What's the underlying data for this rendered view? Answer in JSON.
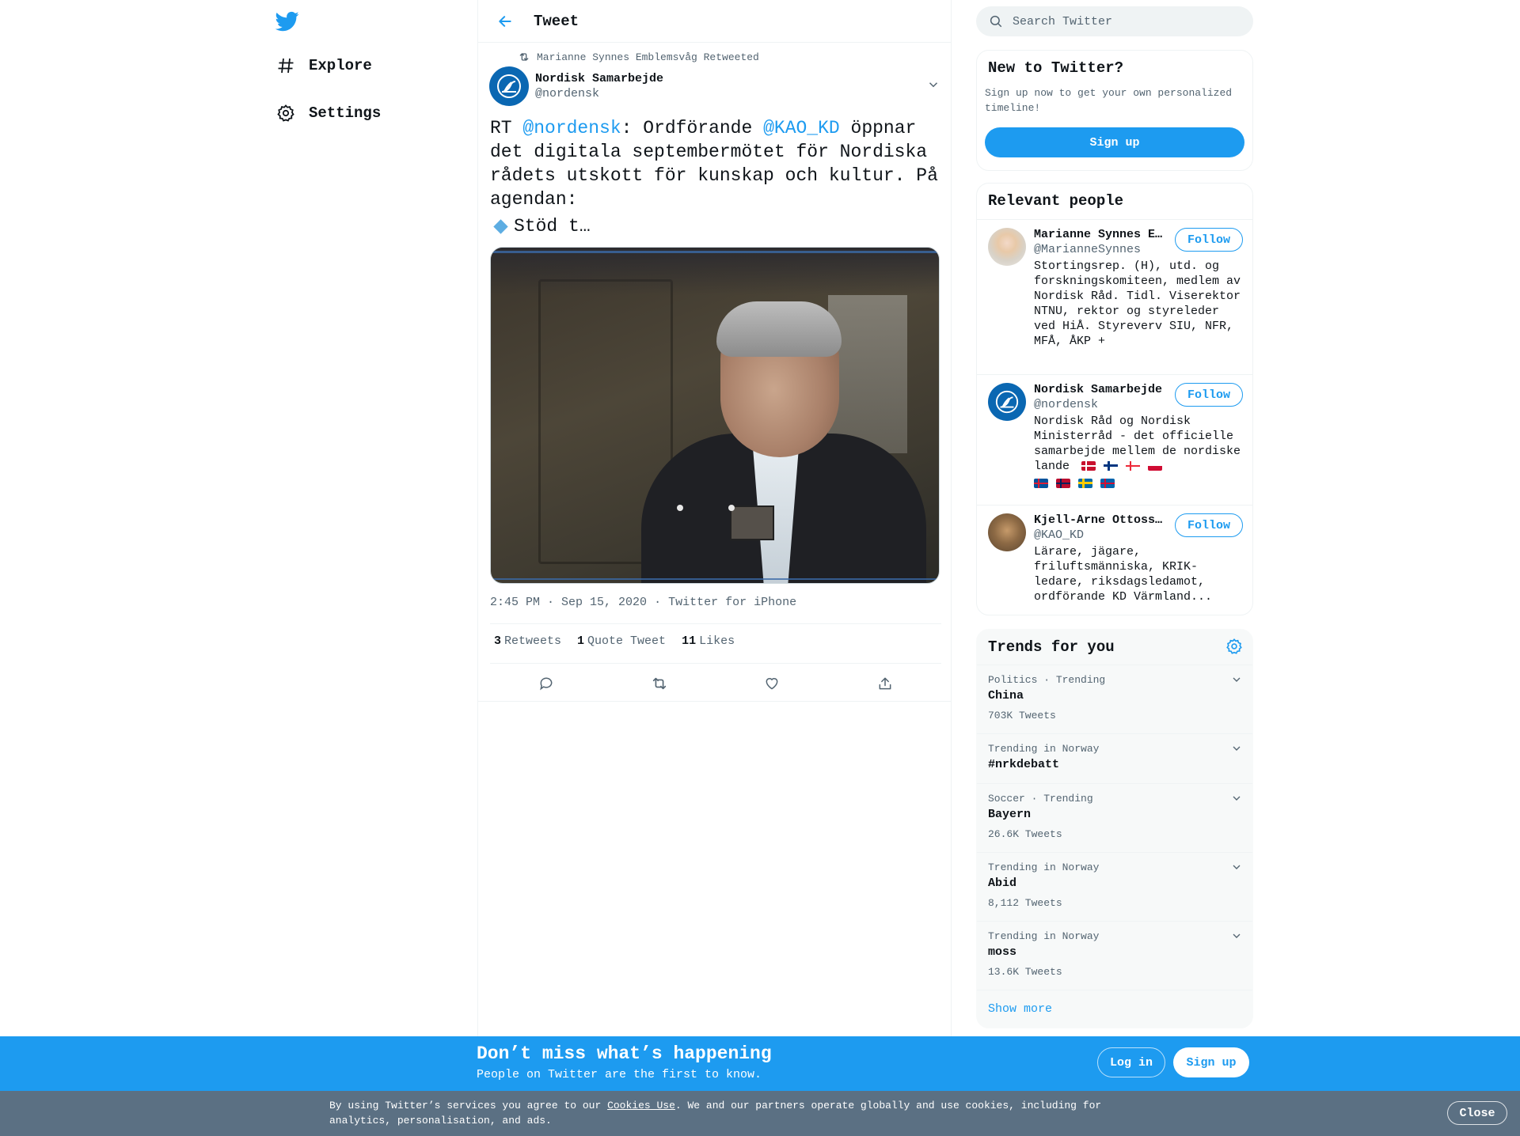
{
  "colors": {
    "accent": "#1d9bf0",
    "muted": "#536471",
    "banner": "#1d9bf0",
    "cookie_banner": "#5b7083"
  },
  "nav": {
    "logo_icon": "twitter-bird-icon",
    "items": [
      {
        "label": "Explore",
        "icon": "hashtag-icon"
      },
      {
        "label": "Settings",
        "icon": "gear-icon"
      }
    ]
  },
  "main": {
    "header_title": "Tweet",
    "retweeted_by": "Marianne Synnes Emblemsvåg Retweeted",
    "author": {
      "name": "Nordisk Samarbejde",
      "handle": "@nordensk"
    },
    "text": {
      "prefix": "RT ",
      "mention1": "@nordensk",
      "middle": ": Ordförande ",
      "mention2": "@KAO_KD",
      "rest": " öppnar det digitala septembermötet för Nordiska rådets utskott för kunskap och kultur. På agendan:",
      "line2": "Stöd t…"
    },
    "meta": {
      "time": "2:45 PM · Sep 15, 2020",
      "source": "Twitter for iPhone"
    },
    "stats": [
      {
        "count": "3",
        "label": "Retweets"
      },
      {
        "count": "1",
        "label": "Quote Tweet"
      },
      {
        "count": "11",
        "label": "Likes"
      }
    ]
  },
  "sidebar": {
    "search_placeholder": "Search Twitter",
    "new_to_twitter": {
      "title": "New to Twitter?",
      "desc": "Sign up now to get your own personalized timeline!",
      "button": "Sign up"
    },
    "relevant_people": {
      "title": "Relevant people",
      "people": [
        {
          "name": "Marianne Synnes E…",
          "handle": "@MarianneSynnes",
          "bio": "Stortingsrep. (H), utd. og forskningskomiteen, medlem av Nordisk Råd. Tidl. Viserektor NTNU, rektor og styreleder ved HiÅ. Styreverv SIU, NFR, MFÅ, ÅKP +",
          "button": "Follow"
        },
        {
          "name": "Nordisk Samarbejde",
          "handle": "@nordensk",
          "bio": "Nordisk Råd og Nordisk Ministerråd - det officielle samarbejde mellem de nordiske lande",
          "button": "Follow"
        },
        {
          "name": "Kjell-Arne Ottoss…",
          "handle": "@KAO_KD",
          "bio": "Lärare, jägare, friluftsmänniska, KRIK-ledare, riksdagsledamot, ordförande KD Värmland...",
          "button": "Follow"
        }
      ]
    },
    "trends": {
      "title": "Trends for you",
      "items": [
        {
          "meta": "Politics · Trending",
          "name": "China",
          "count": "703K Tweets"
        },
        {
          "meta": "Trending in Norway",
          "name": "#nrkdebatt",
          "count": ""
        },
        {
          "meta": "Soccer · Trending",
          "name": "Bayern",
          "count": "26.6K Tweets"
        },
        {
          "meta": "Trending in Norway",
          "name": "Abid",
          "count": "8,112 Tweets"
        },
        {
          "meta": "Trending in Norway",
          "name": "moss",
          "count": "13.6K Tweets"
        }
      ],
      "show_more": "Show more"
    }
  },
  "banner": {
    "title": "Don’t miss what’s happening",
    "subtitle": "People on Twitter are the first to know.",
    "login": "Log in",
    "signup": "Sign up"
  },
  "cookie": {
    "before": "By using Twitter’s services you agree to our ",
    "link": "Cookies Use",
    "after": ". We and our partners operate globally and use cookies, including for analytics, personalisation, and ads.",
    "close": "Close"
  }
}
